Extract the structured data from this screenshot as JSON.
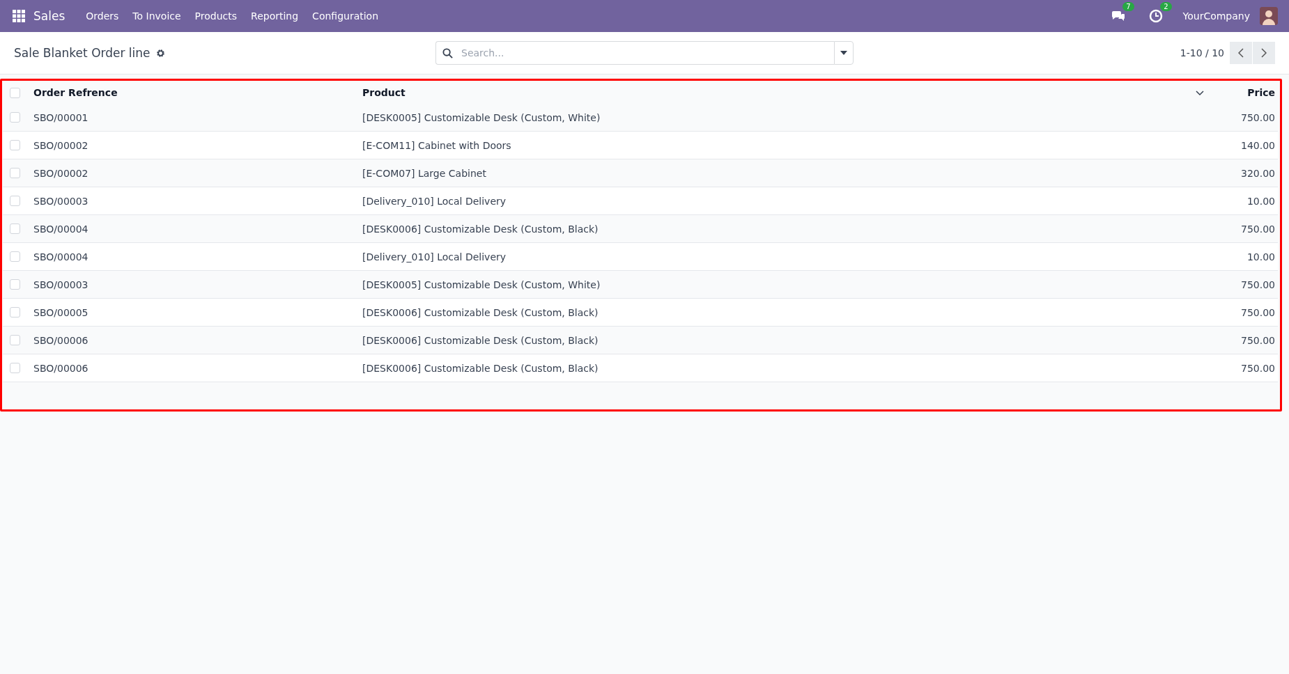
{
  "navbar": {
    "app_name": "Sales",
    "menu": [
      "Orders",
      "To Invoice",
      "Products",
      "Reporting",
      "Configuration"
    ],
    "messages_count": "7",
    "activities_count": "2",
    "company": "YourCompany"
  },
  "control_panel": {
    "title": "Sale Blanket Order line",
    "search": {
      "placeholder": "Search..."
    },
    "pager": "1-10 / 10"
  },
  "table": {
    "all_checked": false,
    "columns": [
      "Order Refrence",
      "Product",
      "Price"
    ],
    "rows": [
      {
        "checked": false,
        "cells": [
          "SBO/00001",
          "[DESK0005] Customizable Desk (Custom, White)",
          "750.00"
        ]
      },
      {
        "checked": false,
        "cells": [
          "SBO/00002",
          "[E-COM11] Cabinet with Doors",
          "140.00"
        ]
      },
      {
        "checked": false,
        "cells": [
          "SBO/00002",
          "[E-COM07] Large Cabinet",
          "320.00"
        ]
      },
      {
        "checked": false,
        "cells": [
          "SBO/00003",
          "[Delivery_010] Local Delivery",
          "10.00"
        ]
      },
      {
        "checked": false,
        "cells": [
          "SBO/00004",
          "[DESK0006] Customizable Desk (Custom, Black)",
          "750.00"
        ]
      },
      {
        "checked": false,
        "cells": [
          "SBO/00004",
          "[Delivery_010] Local Delivery",
          "10.00"
        ]
      },
      {
        "checked": false,
        "cells": [
          "SBO/00003",
          "[DESK0005] Customizable Desk (Custom, White)",
          "750.00"
        ]
      },
      {
        "checked": false,
        "cells": [
          "SBO/00005",
          "[DESK0006] Customizable Desk (Custom, Black)",
          "750.00"
        ]
      },
      {
        "checked": false,
        "cells": [
          "SBO/00006",
          "[DESK0006] Customizable Desk (Custom, Black)",
          "750.00"
        ]
      },
      {
        "checked": false,
        "cells": [
          "SBO/00006",
          "[DESK0006] Customizable Desk (Custom, Black)",
          "750.00"
        ]
      }
    ]
  }
}
